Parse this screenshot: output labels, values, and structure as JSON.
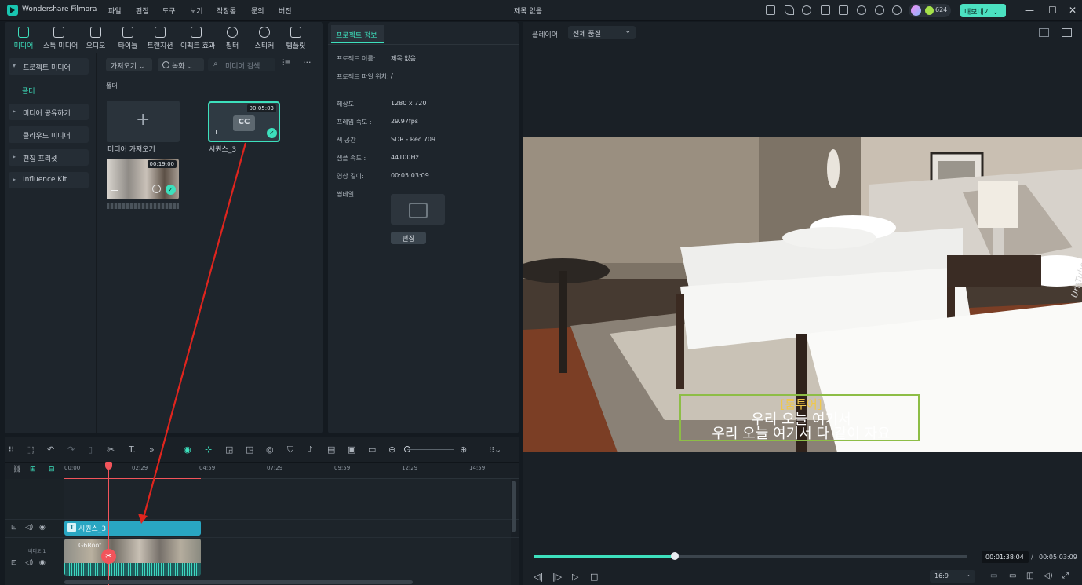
{
  "app": {
    "name": "Wondershare Filmora",
    "doc_title": "제목 없음"
  },
  "menu": [
    "파일",
    "편집",
    "도구",
    "보기",
    "작장통",
    "문의",
    "버전"
  ],
  "credit": {
    "count": "624"
  },
  "export_label": "내보내기",
  "window_controls": {
    "minimize": "—",
    "maximize": "☐",
    "close": "✕"
  },
  "media_tabs": [
    {
      "label": "미디어",
      "icon": "media-icon"
    },
    {
      "label": "스톡 미디어",
      "icon": "stock-icon"
    },
    {
      "label": "오디오",
      "icon": "audio-icon"
    },
    {
      "label": "타이틀",
      "icon": "title-icon"
    },
    {
      "label": "트랜지션",
      "icon": "transition-icon"
    },
    {
      "label": "이펙트 효과",
      "icon": "effects-icon"
    },
    {
      "label": "필터",
      "icon": "filter-icon"
    },
    {
      "label": "스티커",
      "icon": "sticker-icon"
    },
    {
      "label": "템플릿",
      "icon": "template-icon"
    }
  ],
  "sidebar": {
    "items": [
      {
        "label": "프로젝트 미디어"
      },
      {
        "label": "폴더"
      },
      {
        "label": "미디어 공유하기"
      },
      {
        "label": "클라우드 미디어"
      },
      {
        "label": "편집 프리셋"
      },
      {
        "label": "Influence Kit"
      }
    ]
  },
  "media_toolbar": {
    "import_dd": "가져오기",
    "record_dd": "녹화",
    "search_placeholder": "미디어 검색"
  },
  "folder_label": "폴더",
  "media_items": [
    {
      "label": "미디어 가져오기"
    },
    {
      "label": "시퀀스_3",
      "duration": "00:05:03",
      "badge": "CC"
    },
    {
      "label": "",
      "duration": "00:19:00"
    }
  ],
  "project_info": {
    "tab": "프로젝트 정보",
    "rows": [
      {
        "key": "프로젝트 이름:",
        "value": "제목 없음"
      },
      {
        "key": "프로젝트 파일 위치:",
        "value": "/"
      },
      {
        "key": "해상도:",
        "value": "1280 x 720"
      },
      {
        "key": "프레임 속도 :",
        "value": "29.97fps"
      },
      {
        "key": "색 공간 :",
        "value": "SDR - Rec.709"
      },
      {
        "key": "샘플 속도 :",
        "value": "44100Hz"
      },
      {
        "key": "영상 길이:",
        "value": "00:05:03:09"
      },
      {
        "key": "썸네일:",
        "value": ""
      }
    ],
    "edit_button": "편집"
  },
  "player": {
    "label": "플레이어",
    "quality_dd": "전체 품질",
    "subtitle": {
      "speaker": "[룸투어]",
      "line1": "우리 오늘 여기서",
      "line2": "우리 오늘 여기서 다 같이 자요"
    },
    "watermark": "UrnTube",
    "progress": 0.325,
    "current_time": "00:01:38:04",
    "separator": "/",
    "total_time": "00:05:03:09",
    "aspect_ratio": "16:9"
  },
  "timeline": {
    "ruler_ticks": [
      "00:00",
      "02:29",
      "04:59",
      "07:29",
      "09:59",
      "12:29",
      "14:59"
    ],
    "title_clip": "시퀀스_3",
    "video_clip": "G6Roof...",
    "video_track_label": "비디오 1"
  },
  "colors": {
    "accent": "#3de0bd",
    "playhead": "#f2545b",
    "title_clip": "#29a6c2",
    "subtitle_box": "#8dbd46"
  }
}
